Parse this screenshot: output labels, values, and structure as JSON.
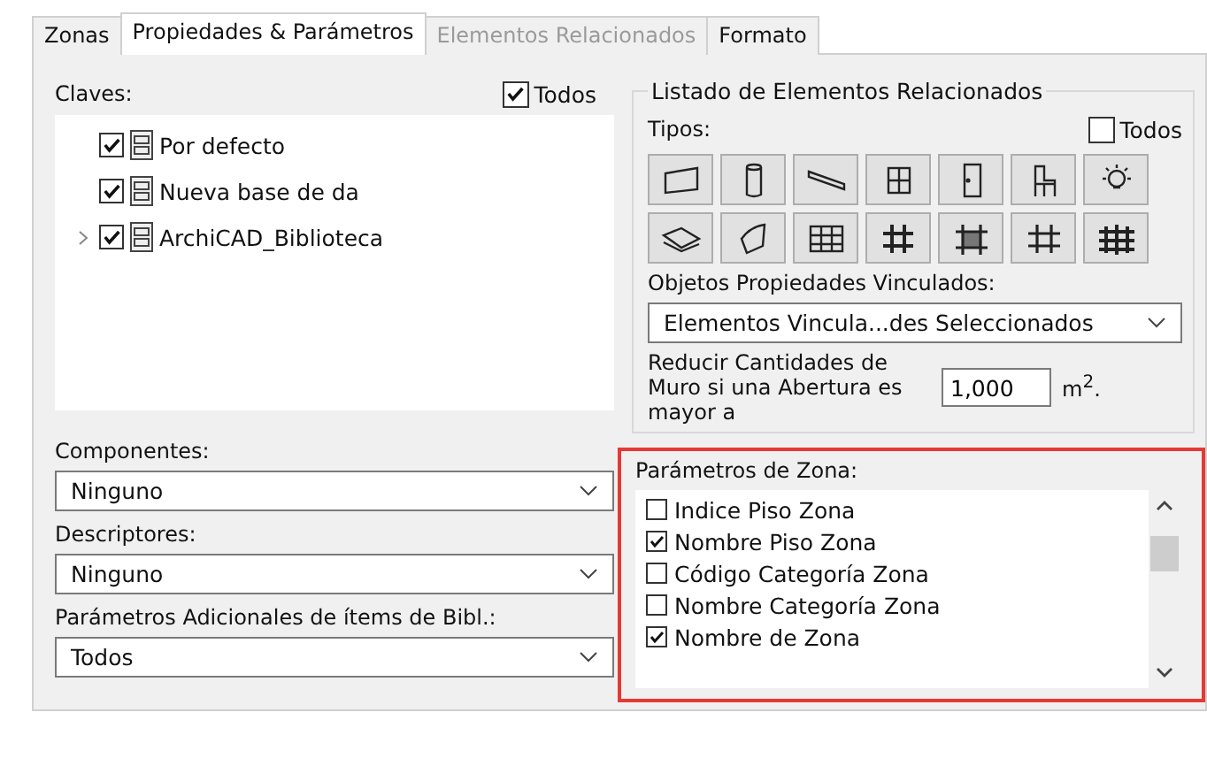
{
  "tabs": [
    {
      "label": "Zonas",
      "selected": false,
      "disabled": false
    },
    {
      "label": "Propiedades & Parámetros",
      "selected": true,
      "disabled": false
    },
    {
      "label": "Elementos Relacionados",
      "selected": false,
      "disabled": true
    },
    {
      "label": "Formato",
      "selected": false,
      "disabled": false
    }
  ],
  "claves": {
    "label": "Claves:",
    "all_label": "Todos",
    "all_checked": true,
    "items": [
      {
        "label": "Por defecto",
        "checked": true,
        "expandable": false
      },
      {
        "label": "Nueva base de da",
        "checked": true,
        "expandable": false
      },
      {
        "label": "ArchiCAD_Biblioteca",
        "checked": true,
        "expandable": true
      }
    ]
  },
  "selects": [
    {
      "label": "Componentes:",
      "value": "Ninguno"
    },
    {
      "label": "Descriptores:",
      "value": "Ninguno"
    },
    {
      "label": "Parámetros Adicionales de ítems de Bibl.:",
      "value": "Todos"
    }
  ],
  "related": {
    "title": "Listado de Elementos Relacionados",
    "types_label": "Tipos:",
    "all_label": "Todos",
    "all_checked": false,
    "linked_label": "Objetos Propiedades Vinculados:",
    "linked_value": "Elementos Vincula...des Seleccionados",
    "reduce_label": "Reducir Cantidades de Muro si una Abertura es mayor a",
    "reduce_value": "1,000",
    "reduce_unit": "m$^{2}$."
  },
  "zone_params": {
    "label": "Parámetros de Zona:",
    "items": [
      {
        "label": "Indice Piso Zona",
        "checked": false
      },
      {
        "label": "Nombre Piso Zona",
        "checked": true
      },
      {
        "label": "Código Categoría Zona",
        "checked": false
      },
      {
        "label": "Nombre Categoría Zona",
        "checked": false
      },
      {
        "label": "Nombre de Zona",
        "checked": true
      }
    ]
  }
}
